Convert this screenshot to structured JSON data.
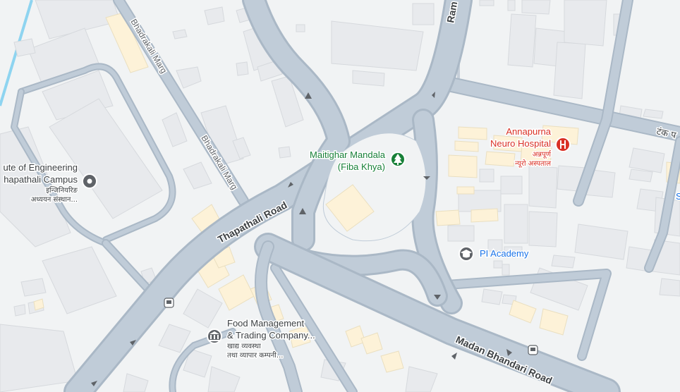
{
  "roads": {
    "thapathali": "Thapathali Road",
    "bhadrakali_1": "Bhadrakali Marg",
    "bhadrakali_2": "Bhadrakali Marg",
    "ram": "Ram",
    "madan": "Madan Bhandari Road",
    "tanka": "टंक प"
  },
  "places": {
    "maitighar": {
      "line1": "Maitighar Mandala",
      "line2": "(Fiba Khya)",
      "icon": "tree-icon",
      "color": "#188038"
    },
    "annapurna": {
      "line1": "Annapurna",
      "line2": "Neuro Hospital",
      "sub1": "अन्नपूर्ण",
      "sub2": "न्यूरो अस्पताल",
      "icon": "hospital-icon",
      "color": "#d93025"
    },
    "engineering": {
      "line1": "ute of Engineering",
      "line2": "hapathali Campus",
      "sub1": "इन्जिनियरिङ",
      "sub2": "अध्ययन संस्थान...",
      "icon": "place-icon",
      "color": "#5f6368"
    },
    "food": {
      "line1": "Food Management",
      "line2": "& Trading Company...",
      "sub1": "खाद्य व्यवस्था",
      "sub2": "तथा व्यापार कम्पनी...",
      "icon": "government-icon",
      "color": "#5f6368"
    },
    "pi": {
      "line1": "PI Academy",
      "icon": "school-icon",
      "color": "#1a73e8"
    },
    "edge": {
      "line1": "S"
    }
  }
}
